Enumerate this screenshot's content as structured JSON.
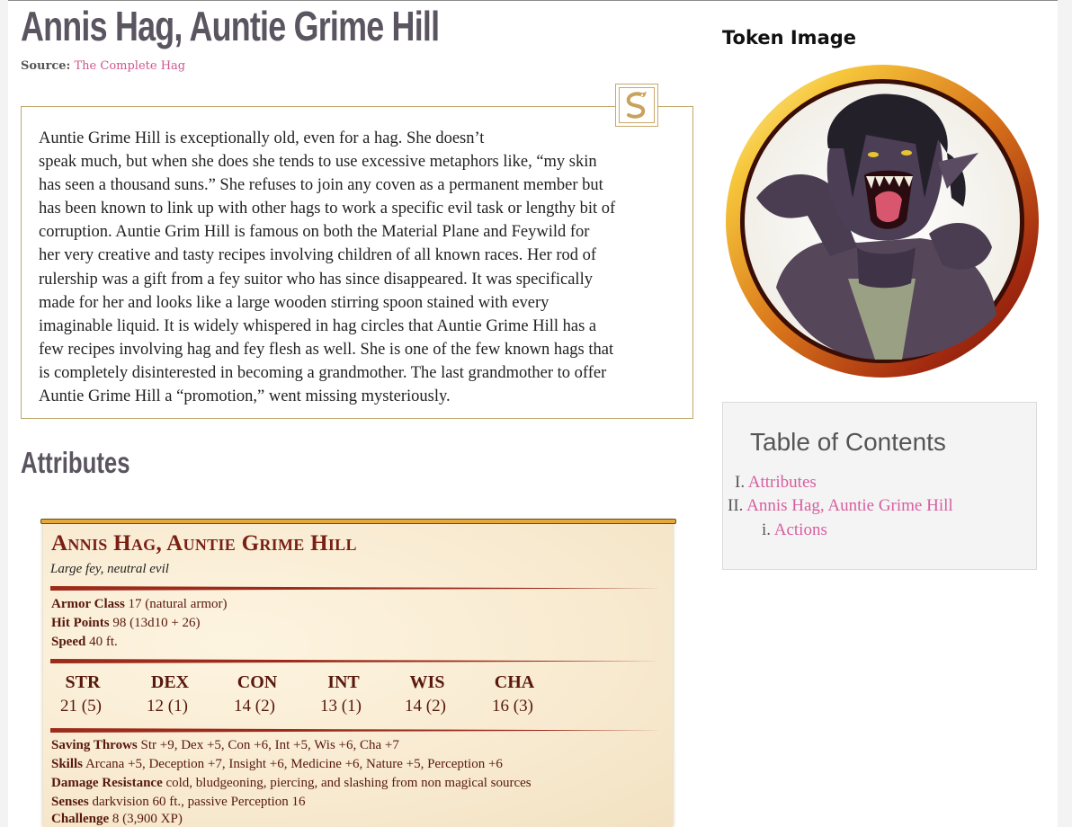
{
  "page": {
    "title": "Annis Hag, Auntie Grime Hill",
    "source_label": "Source:",
    "source_link": "The Complete Hag"
  },
  "flavor": {
    "lines": [
      "Auntie Grime Hill is exceptionally old, even for a hag. She doesn’t",
      "speak much, but when she does she tends to use excessive metaphors like, “my skin",
      "has seen a thousand suns.” She refuses to join any coven as a permanent member but",
      "has been known to link up with other hags to work a specific evil task or lengthy bit of",
      "corruption. Auntie Grim Hill is famous on both the Material Plane and Feywild for",
      "her very creative and tasty recipes involving children of all known races. Her rod of",
      "rulership was a gift from a fey suitor who has since disappeared. It was specifically",
      "made for her and looks like a large wooden stirring spoon stained with every",
      "imaginable liquid. It is widely whispered in hag circles that Auntie Grime Hill has a",
      "few recipes involving hag and fey flesh as well. She is one of the few known hags that",
      "is completely disinterested in becoming a grandmother. The last grandmother to offer",
      "Auntie Grime Hill a “promotion,” went missing mysteriously."
    ]
  },
  "attributes_heading": "Attributes",
  "statblock": {
    "name": "Annis Hag, Auntie Grime Hill",
    "type": "Large fey, neutral evil",
    "armor_class_label": "Armor Class",
    "armor_class": "17 (natural armor)",
    "hit_points_label": "Hit Points",
    "hit_points": "98 (13d10 + 26)",
    "speed_label": "Speed",
    "speed": "40 ft.",
    "abilities": [
      {
        "name": "STR",
        "value": "21 (5)"
      },
      {
        "name": "DEX",
        "value": "12 (1)"
      },
      {
        "name": "CON",
        "value": "14 (2)"
      },
      {
        "name": "INT",
        "value": "13 (1)"
      },
      {
        "name": "WIS",
        "value": "14 (2)"
      },
      {
        "name": "CHA",
        "value": "16 (3)"
      }
    ],
    "saving_throws_label": "Saving Throws",
    "saving_throws": "Str +9, Dex +5, Con +6, Int +5, Wis +6, Cha +7",
    "skills_label": "Skills",
    "skills": "Arcana +5, Deception +7, Insight +6, Medicine +6, Nature +5, Perception +6",
    "damage_resistance_label": "Damage Resistance",
    "damage_resistance": "cold, bludgeoning, piercing, and slashing from non magical sources",
    "senses_label": "Senses",
    "senses": "darkvision 60 ft., passive Perception 16",
    "challenge_label": "Challenge",
    "challenge": "8 (3,900 XP)"
  },
  "token": {
    "heading": "Token Image",
    "image_icon": "hag-token-portrait"
  },
  "toc": {
    "title": "Table of Contents",
    "items": [
      {
        "num": "I.",
        "label": "Attributes"
      },
      {
        "num": "II.",
        "label": "Annis Hag, Auntie Grime Hill"
      },
      {
        "num": "i.",
        "label": "Actions"
      }
    ]
  },
  "colors": {
    "link": "#d65fa0",
    "heading": "#5a5560",
    "statblock_red": "#7a1f14",
    "border_gold": "#bfa76d"
  }
}
